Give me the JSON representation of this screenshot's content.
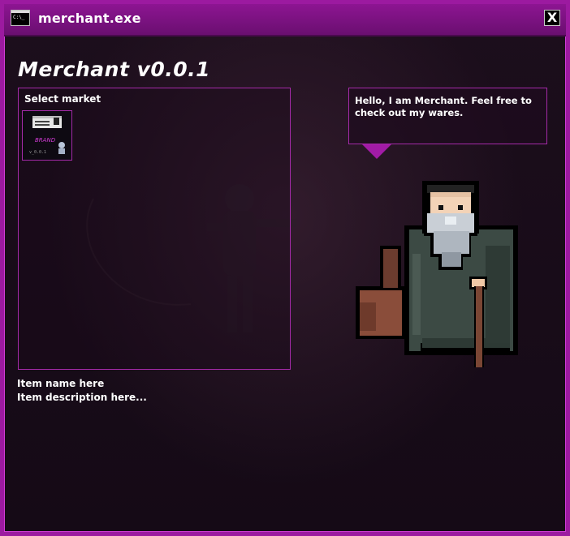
{
  "window": {
    "title": "merchant.exe",
    "close_label": "X",
    "app_icon_text": "C:\\_"
  },
  "heading": "Merchant v0.0.1",
  "market": {
    "label": "Select market",
    "tiles": [
      {
        "icon": "floppy-disk-market-icon",
        "caption": "v_0.0.1"
      }
    ]
  },
  "speech": {
    "text": "Hello, I am Merchant. Feel free to check out my wares."
  },
  "item": {
    "name": "Item name here",
    "description": "Item description here..."
  },
  "colors": {
    "accent": "#9c1aa0",
    "border": "#a42aa8",
    "background": "#1a0a1f"
  }
}
